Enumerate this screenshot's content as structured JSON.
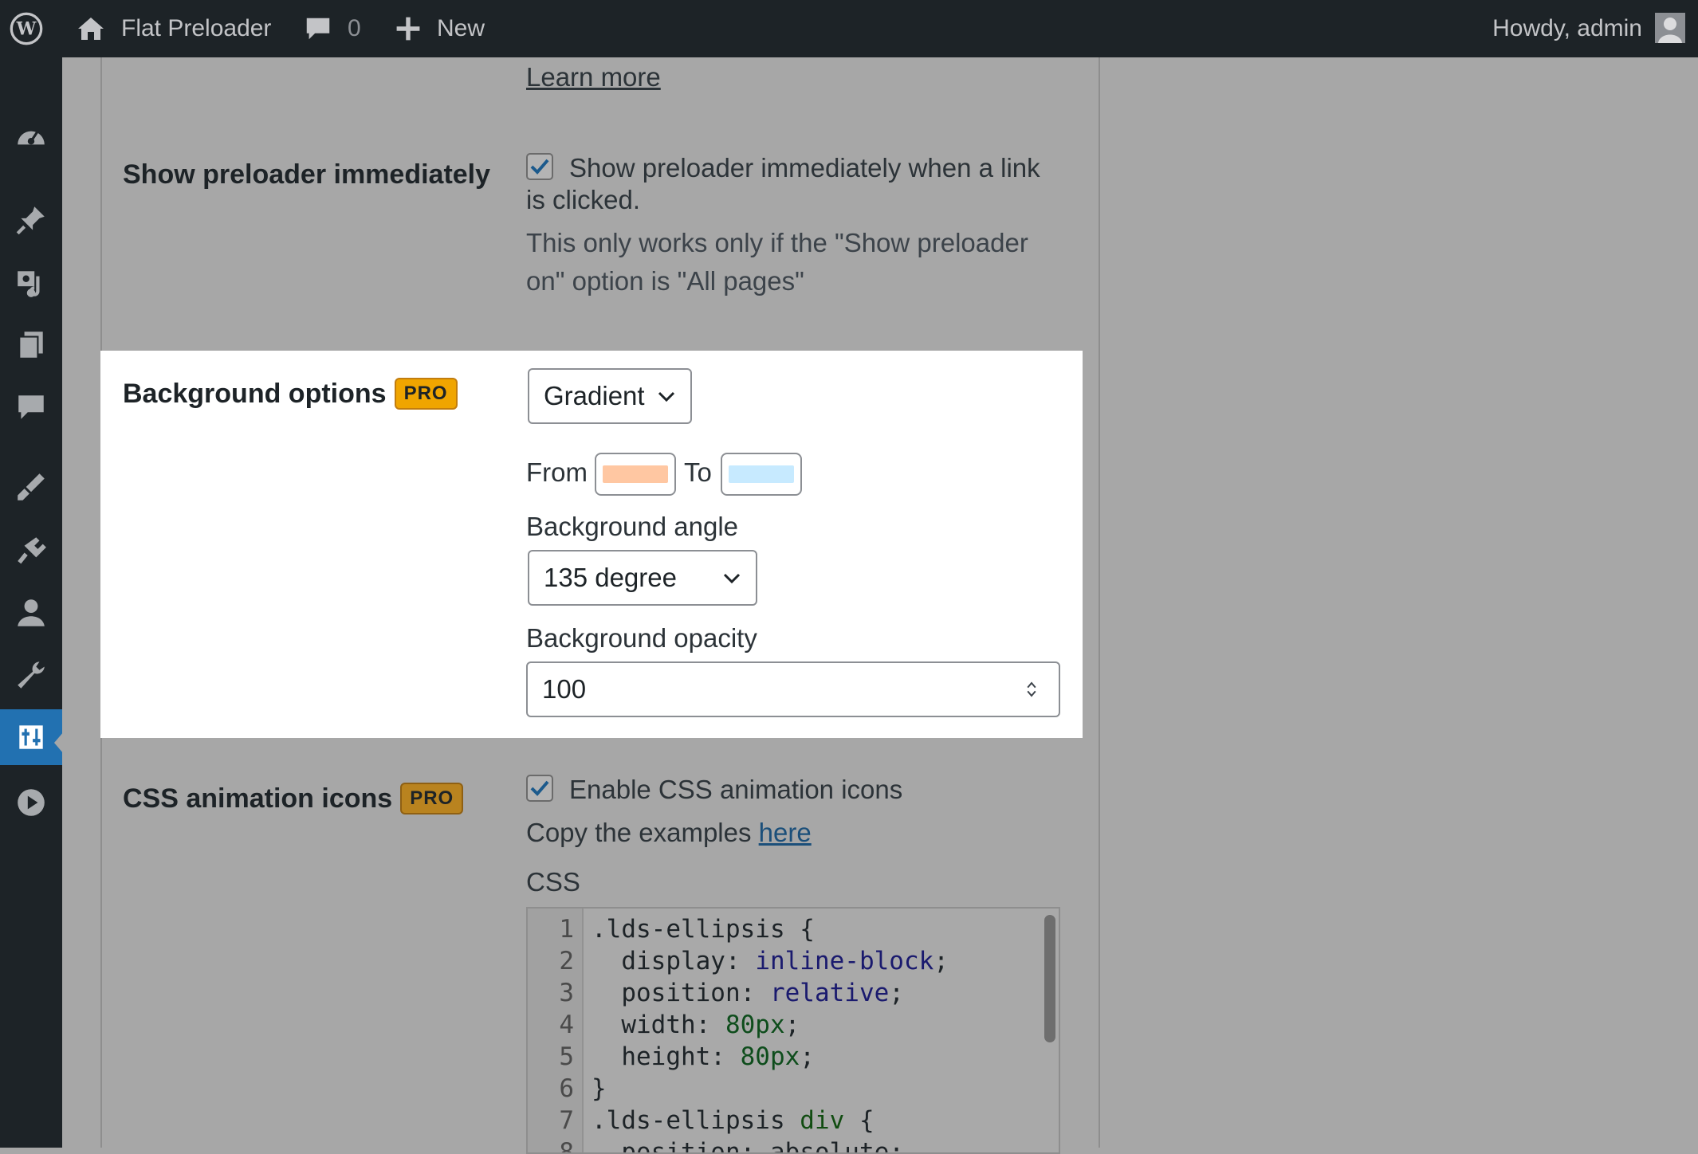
{
  "adminbar": {
    "site_name": "Flat Preloader",
    "comments_count": "0",
    "new_label": "New",
    "howdy": "Howdy, admin"
  },
  "sidebar": {
    "items": [
      "dashboard-icon",
      "pin-icon",
      "media-icon",
      "pages-icon",
      "comments-icon",
      "appearance-icon",
      "plugins-icon",
      "users-icon",
      "tools-icon",
      "settings-icon",
      "play-icon"
    ],
    "active": "settings-icon"
  },
  "top": {
    "learn_more": "Learn more"
  },
  "show_preloader": {
    "label": "Show preloader immediately",
    "checkbox_text_line1": "Show preloader immediately when a link",
    "checkbox_text_line2": "is clicked.",
    "checked": true,
    "desc_line1": "This only works only if the \"Show preloader",
    "desc_line2": "on\" option is \"All pages\""
  },
  "background_options": {
    "label": "Background options",
    "badge": "PRO",
    "type_value": "Gradient",
    "from_label": "From",
    "to_label": "To",
    "from_color": "#ffc7a2",
    "to_color": "#c7eaff",
    "angle_label": "Background angle",
    "angle_value": "135 degree",
    "opacity_label": "Background opacity",
    "opacity_value": "100"
  },
  "css_animation": {
    "label": "CSS animation icons",
    "badge": "PRO",
    "checkbox_text": "Enable CSS animation icons",
    "checked": true,
    "copy_prefix": "Copy the examples ",
    "copy_link": "here",
    "css_label": "CSS",
    "code_lines": [
      {
        "n": "1",
        "text": ".lds-ellipsis {"
      },
      {
        "n": "2",
        "prop": "  display: ",
        "val": "inline-block",
        "end": ";"
      },
      {
        "n": "3",
        "prop": "  position: ",
        "val": "relative",
        "end": ";"
      },
      {
        "n": "4",
        "prop": "  width: ",
        "val": "80px",
        "end": ";"
      },
      {
        "n": "5",
        "prop": "  height: ",
        "val": "80px",
        "end": ";"
      },
      {
        "n": "6",
        "text": "}"
      },
      {
        "n": "7",
        "text": ".lds-ellipsis ",
        "tag": "div",
        "end": " {"
      },
      {
        "n": "8",
        "text": "  position: absolute;"
      }
    ]
  }
}
